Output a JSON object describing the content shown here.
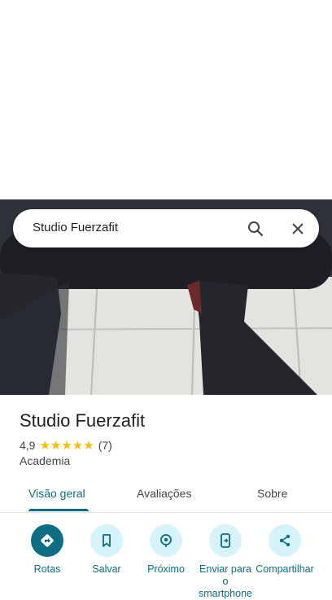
{
  "search": {
    "query": "Studio Fuerzafit"
  },
  "place": {
    "name": "Studio Fuerzafit",
    "rating": "4,9",
    "stars": "★★★★★",
    "review_count": "(7)",
    "category": "Academia"
  },
  "tabs": [
    {
      "label": "Visão geral"
    },
    {
      "label": "Avaliações"
    },
    {
      "label": "Sobre"
    }
  ],
  "actions": [
    {
      "label": "Rotas",
      "icon": "directions-icon"
    },
    {
      "label": "Salvar",
      "icon": "bookmark-icon"
    },
    {
      "label": "Próximo",
      "icon": "nearby-icon"
    },
    {
      "label": "Enviar para o smartphone",
      "icon": "send-to-phone-icon"
    },
    {
      "label": "Compartilhar",
      "icon": "share-icon"
    }
  ],
  "colors": {
    "accent": "#0b6e82",
    "chip_bg": "#d6f3fb",
    "star": "#fbbc04"
  }
}
